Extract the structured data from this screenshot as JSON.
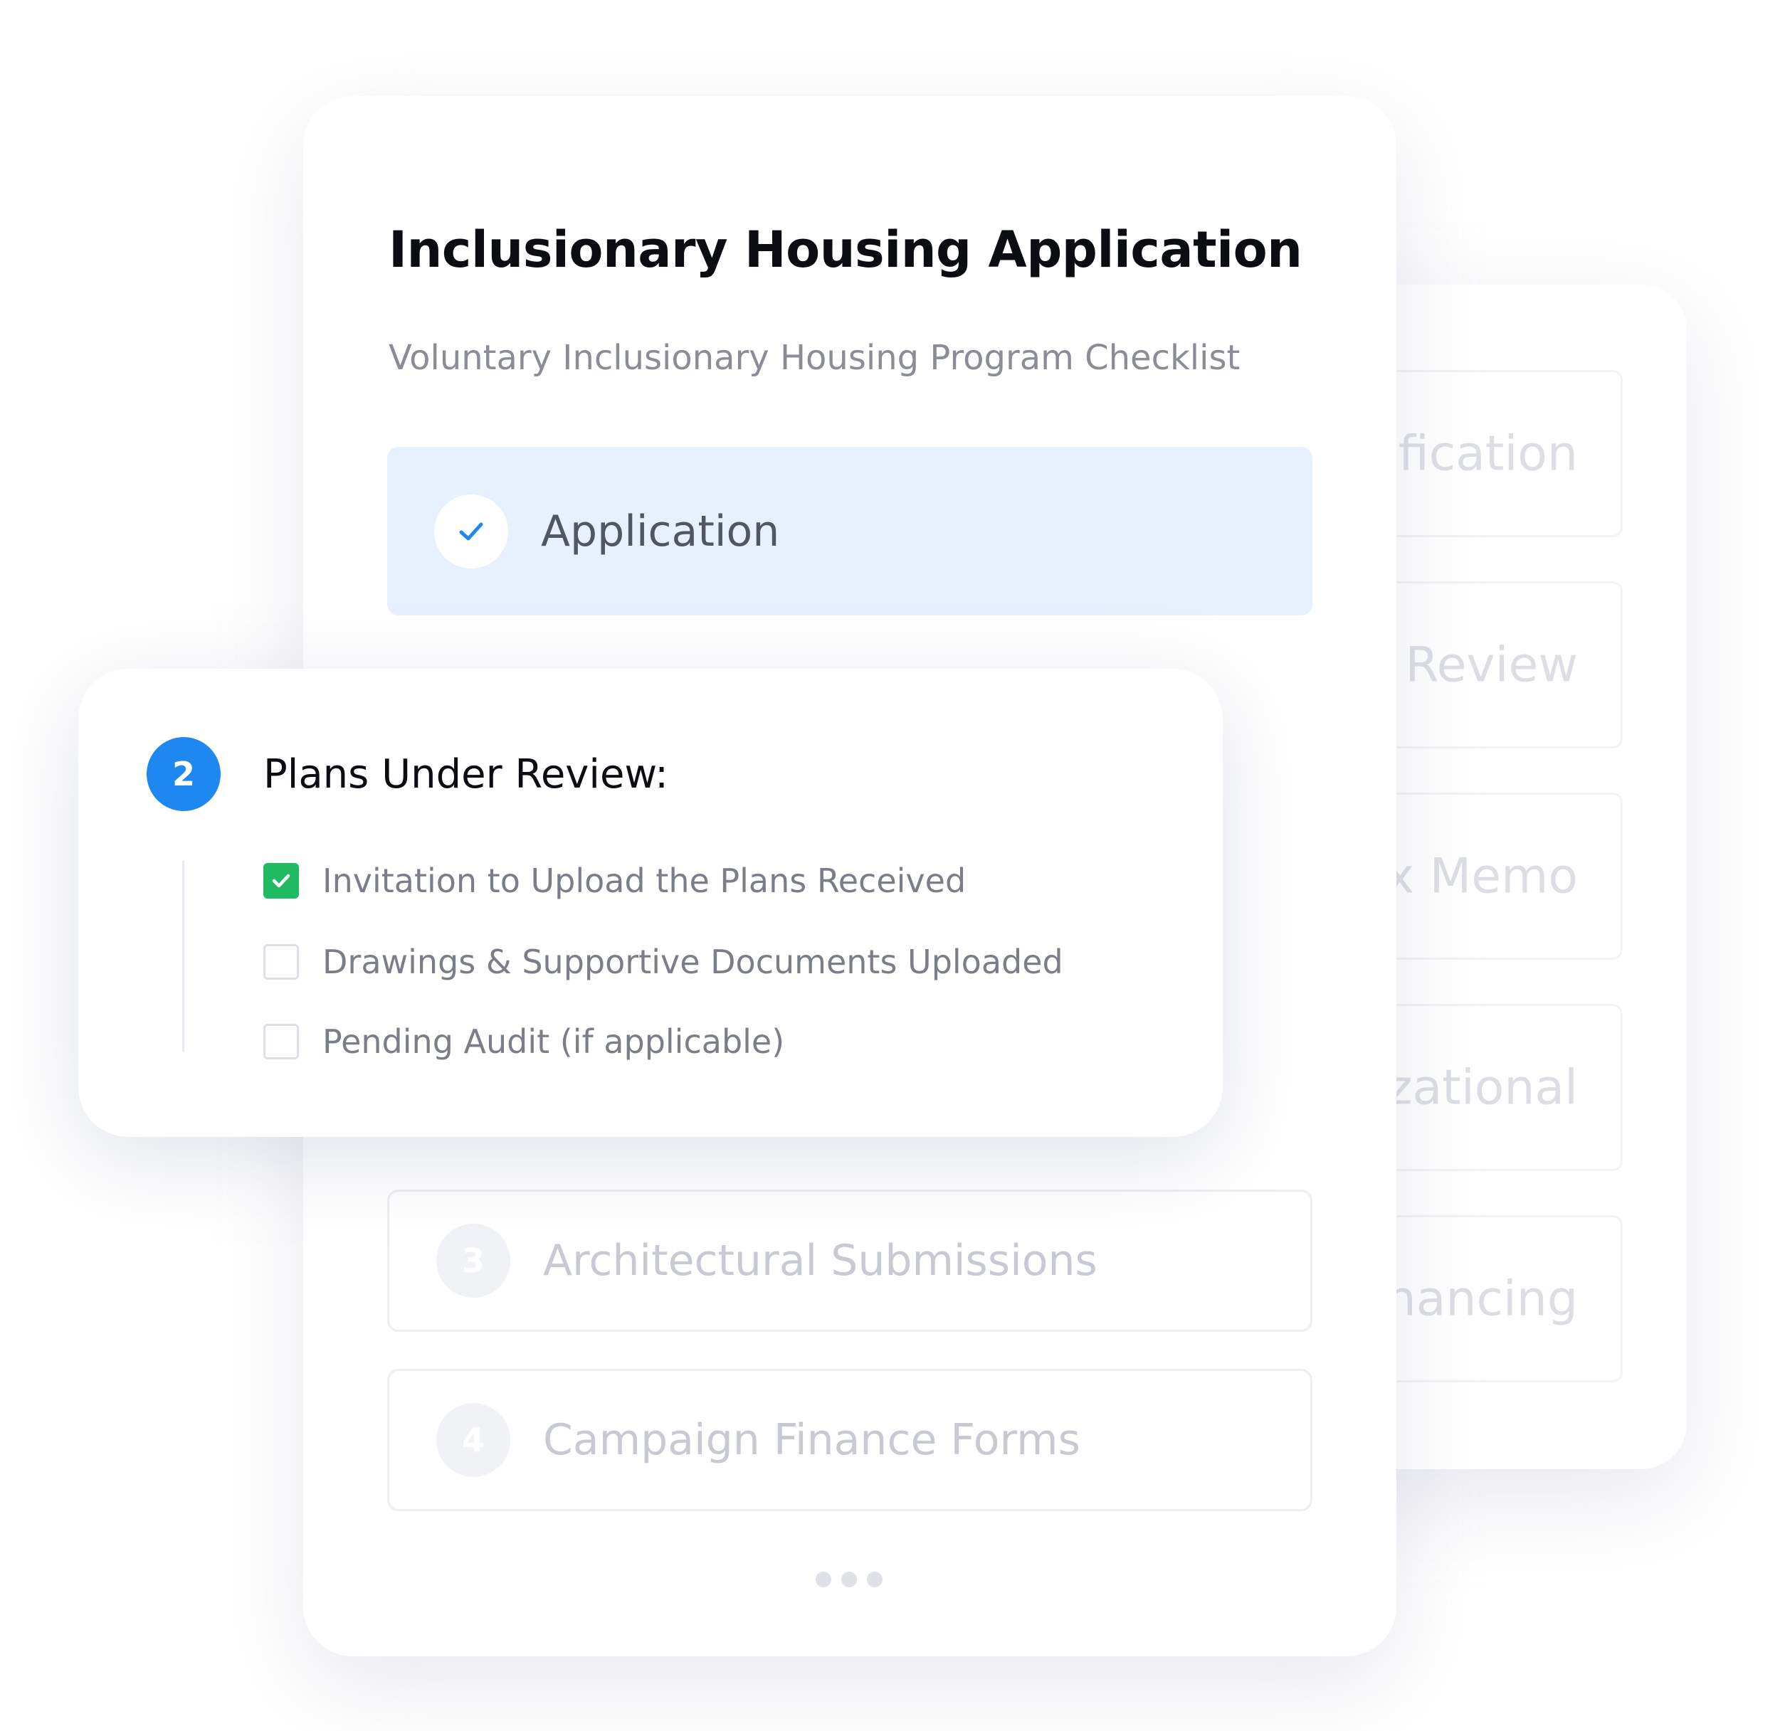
{
  "colors": {
    "accent_blue": "#1f87f0",
    "active_row_bg": "#e7f1fe",
    "check_green": "#1fba62"
  },
  "main_card": {
    "title": "Inclusionary Housing Application",
    "subtitle": "Voluntary Inclusionary Housing Program Checklist",
    "steps": [
      {
        "label": "Application",
        "status": "complete",
        "icon": "check-icon"
      },
      {
        "number": "3",
        "label": "Architectural Submissions",
        "status": "pending"
      },
      {
        "number": "4",
        "label": "Campaign Finance Forms",
        "status": "pending"
      }
    ],
    "pagination": "…"
  },
  "popup": {
    "number": "2",
    "title": "Plans Under Review:",
    "items": [
      {
        "label": "Invitation to Upload the Plans Received",
        "checked": true
      },
      {
        "label": "Drawings & Supportive Documents Uploaded",
        "checked": false
      },
      {
        "label": "Pending Audit (if applicable)",
        "checked": false
      }
    ]
  },
  "back_card": {
    "items": [
      {
        "label": "tification"
      },
      {
        "label": "ty Review"
      },
      {
        "label": "ax Memo"
      },
      {
        "label": "izational"
      },
      {
        "label": "Financing"
      }
    ]
  }
}
